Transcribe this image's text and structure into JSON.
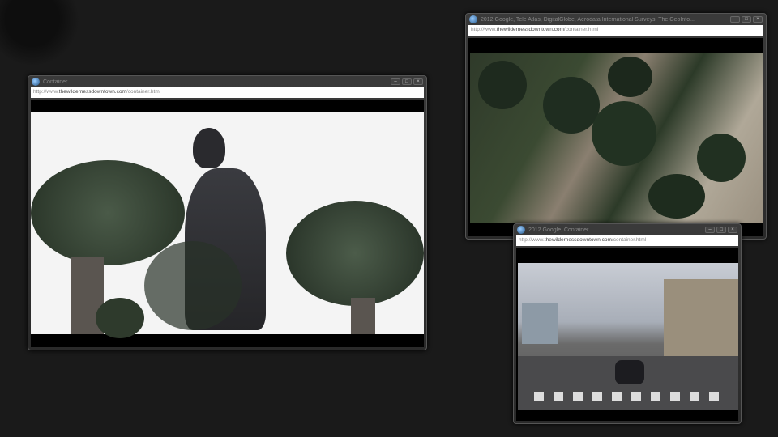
{
  "windows": [
    {
      "title": "Container",
      "url_prefix": "http://www.",
      "url_domain": "thewildernessdowntown.com",
      "url_path": "/container.html",
      "content": "runner-with-trees"
    },
    {
      "title": "2012 Google, Tele Atlas, DigitalGlobe, Aerodata International Surveys, The GeoInfo...",
      "url_prefix": "http://www.",
      "url_domain": "thewildernessdowntown.com",
      "url_path": "/container.html",
      "content": "aerial-map"
    },
    {
      "title": "2012 Google, Container",
      "url_prefix": "http://www.",
      "url_domain": "thewildernessdowntown.com",
      "url_path": "/container.html",
      "content": "street-view"
    }
  ],
  "controls": {
    "minimize": "–",
    "maximize": "□",
    "close": "×"
  }
}
